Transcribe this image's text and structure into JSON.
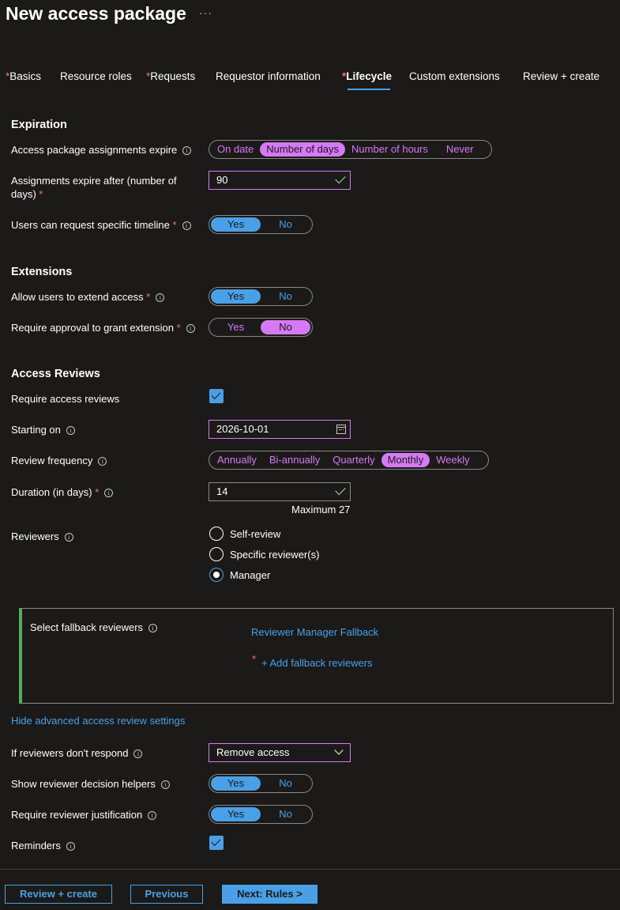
{
  "page_title": "New access package",
  "more_label": "···",
  "tabs": [
    {
      "label": "Basics",
      "required": "*"
    },
    {
      "label": "Resource roles",
      "required": ""
    },
    {
      "label": "Requests",
      "required": "*"
    },
    {
      "label": "Requestor information",
      "required": ""
    },
    {
      "label": "Lifecycle",
      "required": "*"
    },
    {
      "label": "Custom extensions",
      "required": ""
    },
    {
      "label": "Review + create",
      "required": ""
    }
  ],
  "expiration": {
    "heading": "Expiration",
    "expire_label": "Access package assignments expire",
    "expire_options": [
      "On date",
      "Number of days",
      "Number of hours",
      "Never"
    ],
    "expire_selected": "Number of days",
    "days_label_1": "Assignments expire after (number of",
    "days_label_2": "days)",
    "days_value": "90",
    "timeline_label": "Users can request specific timeline",
    "timeline_value": "Yes"
  },
  "extensions": {
    "heading": "Extensions",
    "extend_label": "Allow users to extend access",
    "extend_value": "Yes",
    "approval_label": "Require approval to grant extension",
    "approval_value": "No"
  },
  "reviews": {
    "heading": "Access Reviews",
    "require_label": "Require access reviews",
    "require_checked": true,
    "starting_label": "Starting on",
    "starting_value": "2026-10-01",
    "frequency_label": "Review frequency",
    "frequency_options": [
      "Annually",
      "Bi-annually",
      "Quarterly",
      "Monthly",
      "Weekly"
    ],
    "frequency_selected": "Monthly",
    "duration_label": "Duration (in days)",
    "duration_value": "14",
    "duration_hint": "Maximum 27",
    "reviewers_label": "Reviewers",
    "reviewer_options": [
      "Self-review",
      "Specific reviewer(s)",
      "Manager"
    ],
    "reviewer_selected": "Manager",
    "fallback_label": "Select fallback reviewers",
    "fallback_value": "Reviewer Manager Fallback",
    "add_fallback": "+ Add fallback reviewers",
    "advanced_link": "Hide advanced access review settings",
    "no_response_label": "If reviewers don't respond",
    "no_response_value": "Remove access",
    "helpers_label": "Show reviewer decision helpers",
    "helpers_value": "Yes",
    "justification_label": "Require reviewer justification",
    "justification_value": "Yes",
    "reminders_label": "Reminders",
    "reminders_checked": true
  },
  "toggle_labels": {
    "yes": "Yes",
    "no": "No"
  },
  "required_marker": "*",
  "info_glyph": "i",
  "footer": {
    "review_create": "Review + create",
    "previous": "Previous",
    "next": "Next: Rules >"
  },
  "colors": {
    "background": "#1b1a19",
    "accent_blue": "#4aa0e6",
    "accent_pink": "#d679f5",
    "required_red": "#f1707b",
    "success_green": "#54b054"
  }
}
